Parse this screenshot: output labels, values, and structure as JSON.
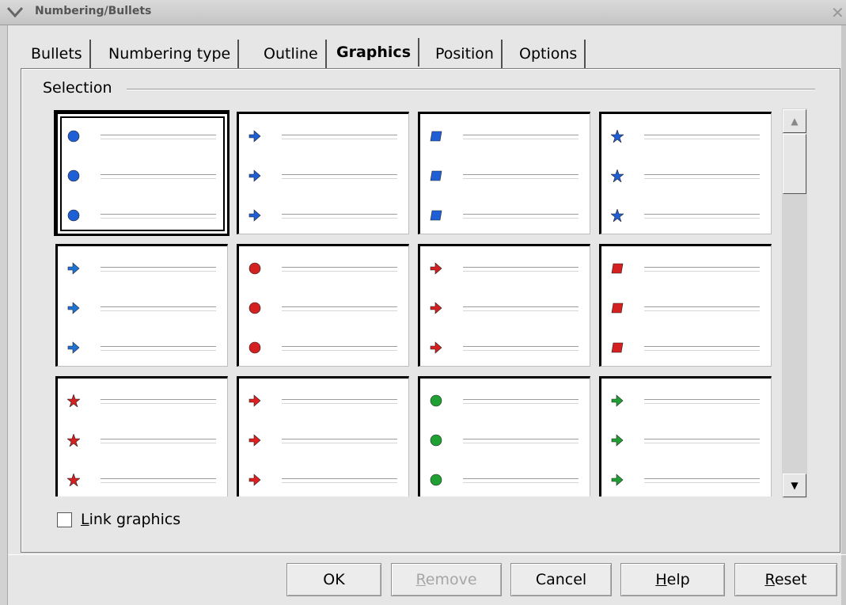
{
  "window": {
    "title": "Numbering/Bullets",
    "close_glyph": "✕"
  },
  "tabs": [
    {
      "label": "Bullets"
    },
    {
      "label": "Numbering type"
    },
    {
      "label": "Outline"
    },
    {
      "label": "Graphics"
    },
    {
      "label": "Position"
    },
    {
      "label": "Options"
    }
  ],
  "active_tab": "Graphics",
  "selection": {
    "label": "Selection",
    "selected_index": 0,
    "bullets": [
      {
        "shape": "ball",
        "color": "#1f5fd6",
        "icon": "blue-ball-bullet-icon"
      },
      {
        "shape": "arrow",
        "color": "#1f5fd6",
        "icon": "blue-arrow-bullet-icon"
      },
      {
        "shape": "square",
        "color": "#1f5fd6",
        "icon": "blue-square-bullet-icon"
      },
      {
        "shape": "star",
        "color": "#1f5fd6",
        "icon": "blue-star-bullet-icon"
      },
      {
        "shape": "arrow",
        "color": "#1f72d6",
        "icon": "blue-arrow-bullet-icon"
      },
      {
        "shape": "ball",
        "color": "#d42020",
        "icon": "red-ball-bullet-icon"
      },
      {
        "shape": "arrow",
        "color": "#d42020",
        "icon": "red-arrow-bullet-icon"
      },
      {
        "shape": "square",
        "color": "#d42020",
        "icon": "red-square-bullet-icon"
      },
      {
        "shape": "star",
        "color": "#d42020",
        "icon": "red-star-bullet-icon"
      },
      {
        "shape": "arrow",
        "color": "#e02020",
        "icon": "red-arrow-bullet-icon"
      },
      {
        "shape": "ball",
        "color": "#1ea032",
        "icon": "green-ball-bullet-icon"
      },
      {
        "shape": "arrow",
        "color": "#1ea032",
        "icon": "green-arrow-bullet-icon"
      }
    ]
  },
  "link_graphics": {
    "label_prefix": "",
    "label_accel": "L",
    "label_rest": "ink graphics",
    "checked": false
  },
  "buttons": {
    "ok": "OK",
    "remove_accel": "R",
    "remove_rest": "emove",
    "cancel": "Cancel",
    "help_accel": "H",
    "help_rest": "elp",
    "reset_accel": "R",
    "reset_rest": "eset"
  },
  "scrollbar": {
    "up_glyph": "▲",
    "down_glyph": "▼"
  }
}
